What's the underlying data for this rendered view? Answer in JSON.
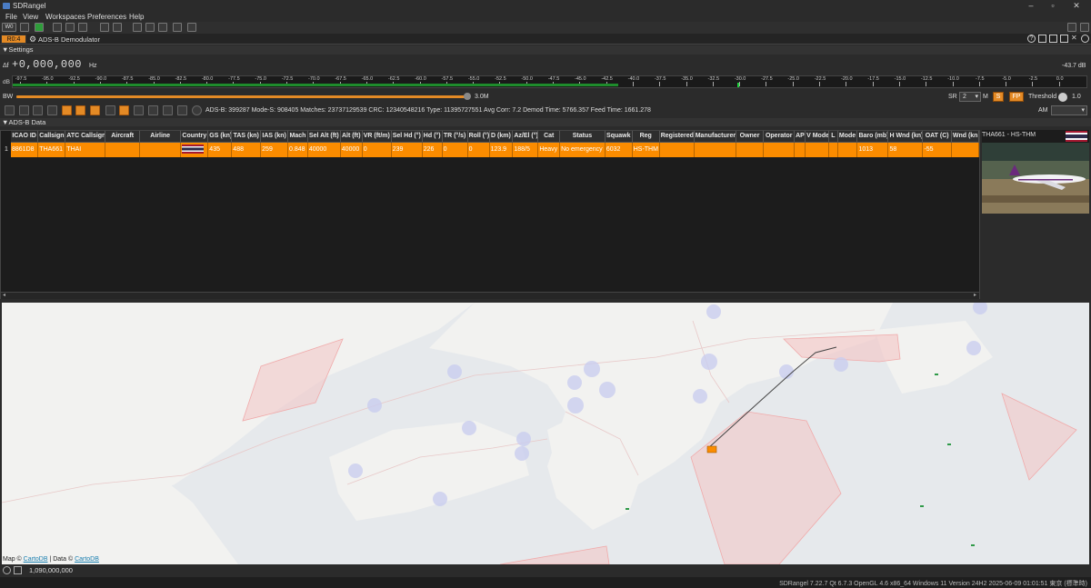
{
  "window": {
    "title": "SDRangel"
  },
  "menu": [
    "File",
    "View",
    "Workspaces",
    "Preferences",
    "Help"
  ],
  "toolbar": {
    "workspace_label": "W0"
  },
  "tab": {
    "badge": "R0:4",
    "title": "ADS-B Demodulator"
  },
  "settings": {
    "header": "Settings",
    "delta_label": "Δf",
    "freq_value": "+0,000,000",
    "freq_unit": "Hz",
    "level": "-43.7 dB",
    "db_label": "dB",
    "scale_top": [
      "-97.5",
      "-95.0",
      "-92.5",
      "-90.0",
      "-87.5",
      "-85.0",
      "-82.5",
      "-80.0",
      "-77.5",
      "-75.0",
      "-72.5",
      "-70.0",
      "-67.5",
      "-65.0",
      "-62.5",
      "-60.0",
      "-57.5",
      "-55.0",
      "-52.5",
      "-50.0",
      "-47.5",
      "-45.0",
      "-42.5",
      "-40.0",
      "-37.5",
      "-35.0",
      "-32.5",
      "-30.0",
      "-27.5",
      "-25.0",
      "-22.5",
      "-20.0",
      "-17.5",
      "-15.0",
      "-12.5",
      "-10.0",
      "-7.5",
      "-5.0",
      "-2.5",
      "0.0"
    ],
    "bw_label": "BW",
    "bw_value": "3.0M",
    "sr_label": "SR",
    "sr_value": "2",
    "m_label": "M",
    "s_label": "S",
    "fp_label": "FP",
    "threshold_label": "Threshold",
    "threshold_value": "1.0",
    "am_label": "AM"
  },
  "status": {
    "text": "ADS-B: 399287 Mode-S: 908405 Matches: 23737129539 CRC: 12340548216 Type: 11395727551 Avg Corr: 7.2 Demod Time: 5766.357 Feed Time: 1661.278"
  },
  "adsb": {
    "header": "ADS-B Data",
    "columns": [
      "ICAO ID",
      "Callsign",
      "ATC Callsign",
      "Aircraft",
      "Airline",
      "Country",
      "GS (kn)",
      "TAS (kn)",
      "IAS (kn)",
      "Mach",
      "Sel Alt (ft)",
      "Alt (ft)",
      "VR (ft/m)",
      "Sel Hd (°)",
      "Hd (°)",
      "TR (°/s)",
      "Roll (°)",
      "D (km)",
      "Az/El (°)",
      "Cat",
      "Status",
      "Squawk",
      "Reg",
      "Registered",
      "Manufacturer",
      "Owner",
      "Operator",
      "AP",
      "V Mode",
      "L",
      "Mode",
      "Baro (mb)",
      "H Wnd (kn)",
      "OAT (C)",
      "Wnd (kn"
    ],
    "rows": [
      [
        "8861D8",
        "THA661",
        "THAI",
        "",
        "",
        "",
        "435",
        "488",
        "259",
        "0.848",
        "40000",
        "40000",
        "0",
        "239",
        "226",
        "0",
        "0",
        "123.9",
        "188/5",
        "Heavy",
        "No emergency",
        "6032",
        "HS-THM",
        "",
        "",
        "",
        "",
        "",
        "",
        "",
        "",
        "1013",
        "58",
        "-55",
        ""
      ]
    ],
    "row_number": "1",
    "photo_title": "THA661 - HS-THM"
  },
  "map": {
    "attribution_prefix": "Map © ",
    "attribution_link1": "CartoDB",
    "attribution_mid": " | Data © ",
    "attribution_link2": "CartoDB"
  },
  "frequency_readout": "1,090,000,000",
  "footer": "SDRangel 7.22.7 Qt 6.7.3 OpenGL 4.6 x86_64 Windows 11 Version 24H2   2025-06-09 01:01:51 東京 (標準時)",
  "colors": {
    "accent": "#fb8c00",
    "window_bg": "#2b2b2b",
    "map_bg": "#e8ebee"
  }
}
